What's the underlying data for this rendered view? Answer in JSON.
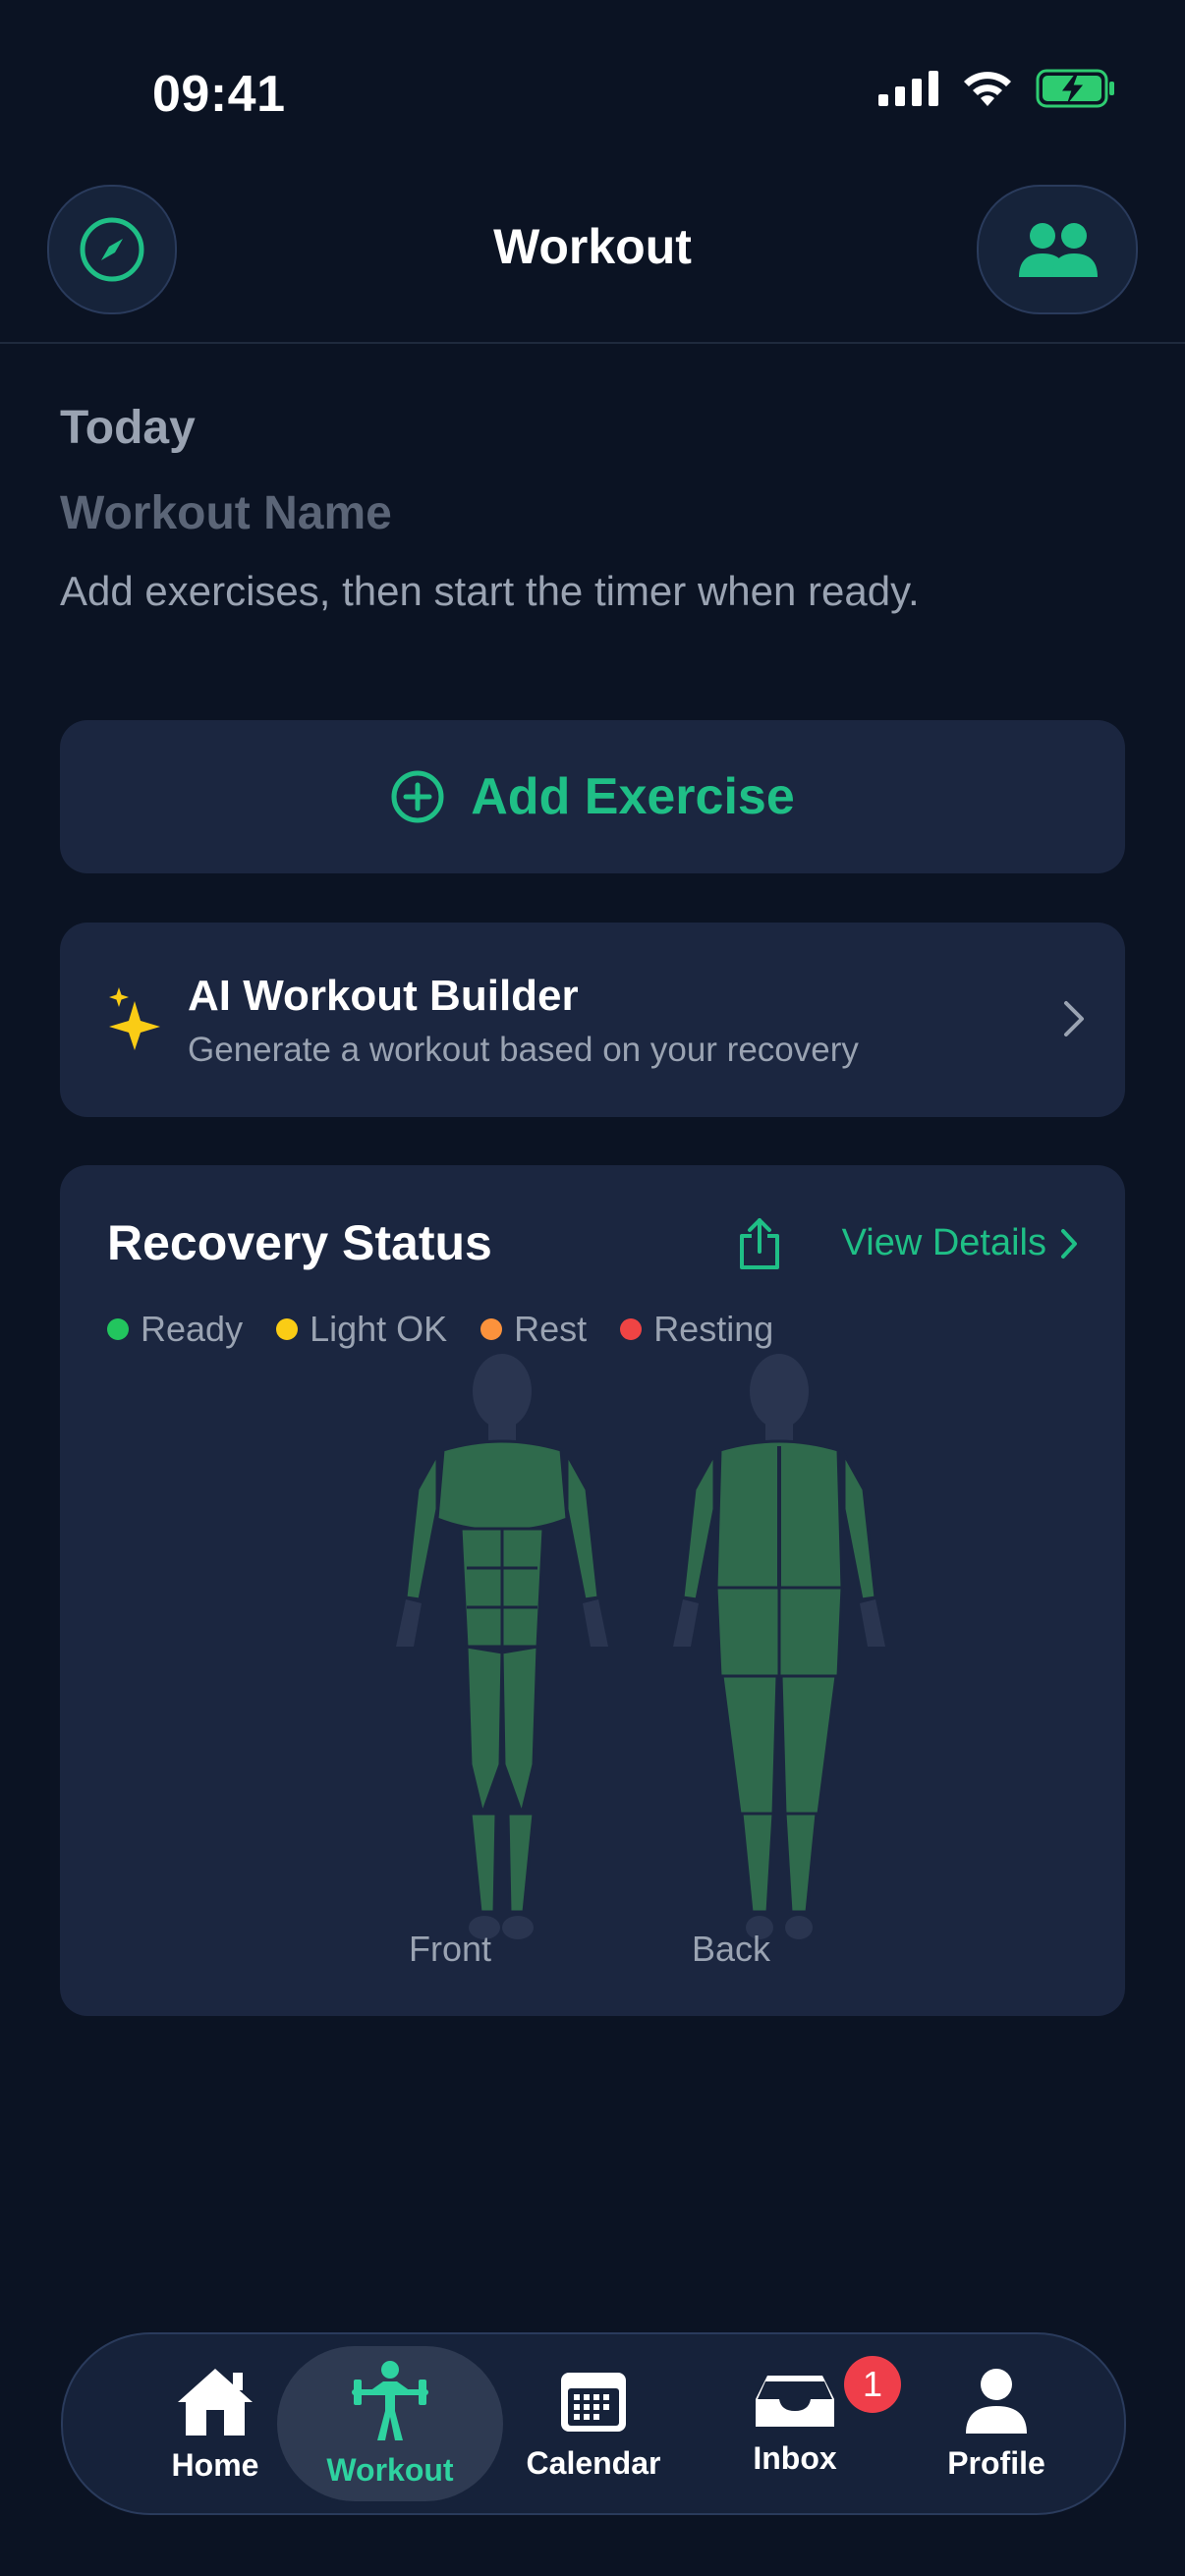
{
  "status_bar": {
    "time": "09:41",
    "icons": [
      "signal-icon",
      "wifi-icon",
      "battery-charging-icon"
    ]
  },
  "nav": {
    "title": "Workout",
    "left_icon": "compass-icon",
    "right_icon": "people-icon"
  },
  "header": {
    "day": "Today",
    "workout_name_placeholder": "Workout Name",
    "subtitle": "Add exercises, then start the timer when ready."
  },
  "add_exercise": {
    "label": "Add Exercise",
    "icon": "plus-circle-icon"
  },
  "ai_builder": {
    "title": "AI Workout Builder",
    "subtitle": "Generate a workout based on your recovery",
    "icon": "sparkle-icon"
  },
  "recovery": {
    "title": "Recovery Status",
    "view_details": "View Details",
    "legend": [
      {
        "label": "Ready",
        "color": "#22c55e"
      },
      {
        "label": "Light OK",
        "color": "#facc15"
      },
      {
        "label": "Rest",
        "color": "#fb923c"
      },
      {
        "label": "Resting",
        "color": "#ef4444"
      }
    ],
    "front_label": "Front",
    "back_label": "Back"
  },
  "tabs": [
    {
      "label": "Home",
      "icon": "home-icon",
      "active": false
    },
    {
      "label": "Workout",
      "icon": "barbell-icon",
      "active": true
    },
    {
      "label": "Calendar",
      "icon": "calendar-icon",
      "active": false
    },
    {
      "label": "Inbox",
      "icon": "inbox-icon",
      "active": false,
      "badge": "1"
    },
    {
      "label": "Profile",
      "icon": "profile-icon",
      "active": false
    }
  ],
  "colors": {
    "accent": "#1fbf86",
    "background": "#0b1323",
    "card": "#1b2640",
    "muscle": "#2f6a4c"
  }
}
